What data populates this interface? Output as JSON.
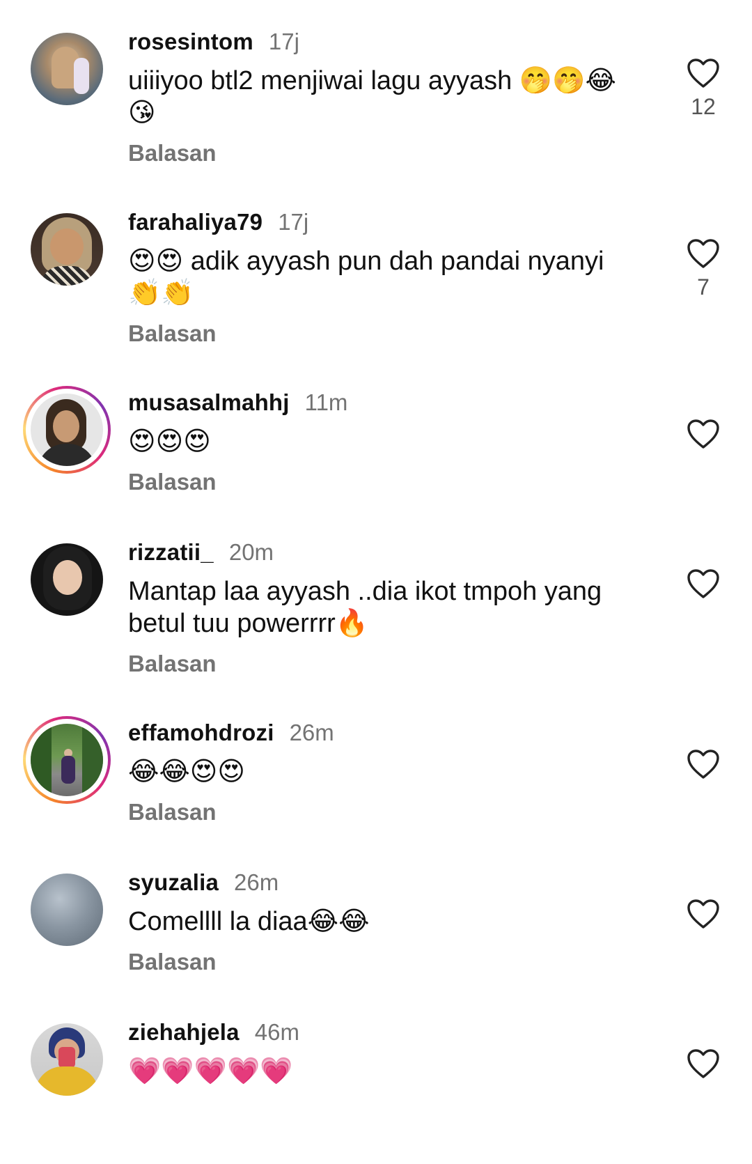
{
  "reply_label": "Balasan",
  "colors": {
    "time": "#737373",
    "reply": "#737373",
    "story_ring": "#dd2a7b"
  },
  "comments": [
    {
      "username": "rosesintom",
      "time": "17j",
      "text": "uiiiyoo btl2 menjiwai lagu ayyash 🤭🤭😂😘",
      "likes": "12",
      "story": false
    },
    {
      "username": "farahaliya79",
      "time": "17j",
      "text": "😍😍 adik ayyash pun dah pandai nyanyi 👏👏",
      "likes": "7",
      "story": false
    },
    {
      "username": "musasalmahhj",
      "time": "11m",
      "text": "😍😍😍",
      "likes": "",
      "story": true
    },
    {
      "username": "rizzatii_",
      "time": "20m",
      "text": "Mantap laa ayyash ..dia ikot tmpoh yang betul tuu powerrrr🔥",
      "likes": "",
      "story": false
    },
    {
      "username": "effamohdrozi",
      "time": "26m",
      "text": "😂😂😍😍",
      "likes": "",
      "story": true
    },
    {
      "username": "syuzalia",
      "time": "26m",
      "text": "Comellll la diaa😂😂",
      "likes": "",
      "story": false
    },
    {
      "username": "ziehahjela",
      "time": "46m",
      "text": "💗💗💗💗💗",
      "likes": "",
      "story": false
    }
  ]
}
